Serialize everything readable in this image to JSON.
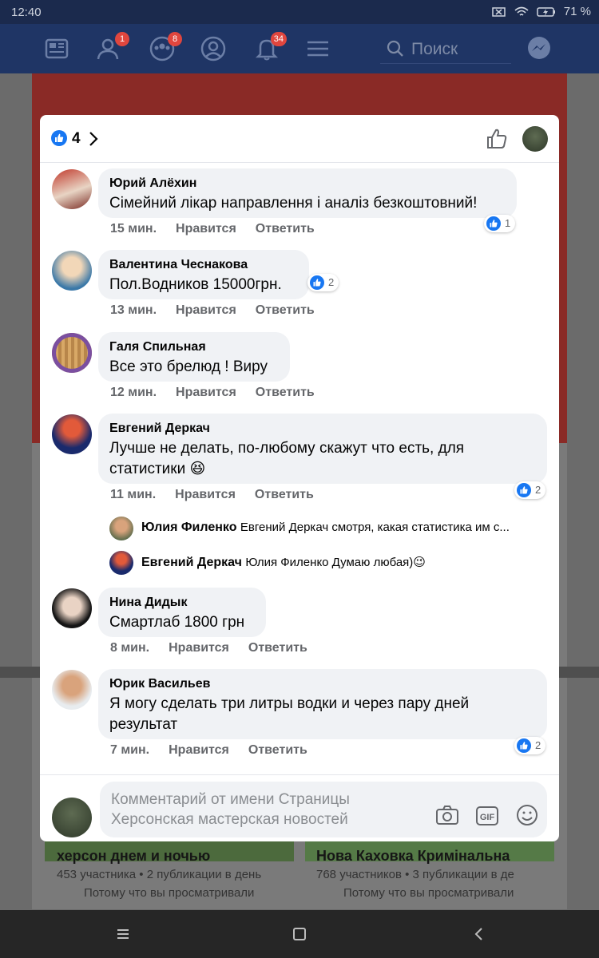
{
  "status_bar": {
    "time": "12:40",
    "battery": "71 %"
  },
  "nav": {
    "badges": {
      "friends": "1",
      "groups": "8",
      "notifications": "34"
    },
    "search_placeholder": "Поиск"
  },
  "background_cards": [
    {
      "title": "херсон днем и ночью",
      "subtitle": "453 участника • 2 публикации в день",
      "reason": "Потому что вы просматривали"
    },
    {
      "title": "Нова Каховка Кримінальна",
      "subtitle": "768 участников • 3 публикации в де",
      "reason": "Потому что вы просматривали"
    }
  ],
  "modal": {
    "reaction_count": "4",
    "comments": [
      {
        "author": "Юрий Алёхин",
        "text": "Сімейний лікар направлення і аналіз безкоштовний!",
        "time": "15 мин.",
        "like": "Нравится",
        "reply": "Ответить",
        "reactions": "1"
      },
      {
        "author": "Валентина Чеснакова",
        "text": "Пол.Водников 15000грн.",
        "time": "13 мин.",
        "like": "Нравится",
        "reply": "Ответить",
        "reactions": "2"
      },
      {
        "author": "Галя Спильная",
        "text": "Все это брелюд ! Виру",
        "time": "12 мин.",
        "like": "Нравится",
        "reply": "Ответить"
      },
      {
        "author": "Евгений Деркач",
        "text": "Лучше не делать, по-любому скажут что есть, для статистики 😆",
        "time": "11 мин.",
        "like": "Нравится",
        "reply": "Ответить",
        "reactions": "2"
      },
      {
        "author": "Нина Дидык",
        "text": "Смартлаб 1800 грн",
        "time": "8 мин.",
        "like": "Нравится",
        "reply": "Ответить"
      },
      {
        "author": "Юрик Васильев",
        "text": "Я могу сделать три литры водки и через пару дней результат",
        "time": "7 мин.",
        "like": "Нравится",
        "reply": "Ответить",
        "reactions": "2"
      }
    ],
    "replies": [
      {
        "author": "Юлия Филенко",
        "text": "Евгений Деркач смотря, какая статистика им с..."
      },
      {
        "author": "Евгений Деркач",
        "text": "Юлия Филенко Думаю любая)😉"
      }
    ],
    "composer": {
      "line1": "Комментарий от имени Страницы",
      "line2": "Херсонская мастерская новостей"
    }
  }
}
